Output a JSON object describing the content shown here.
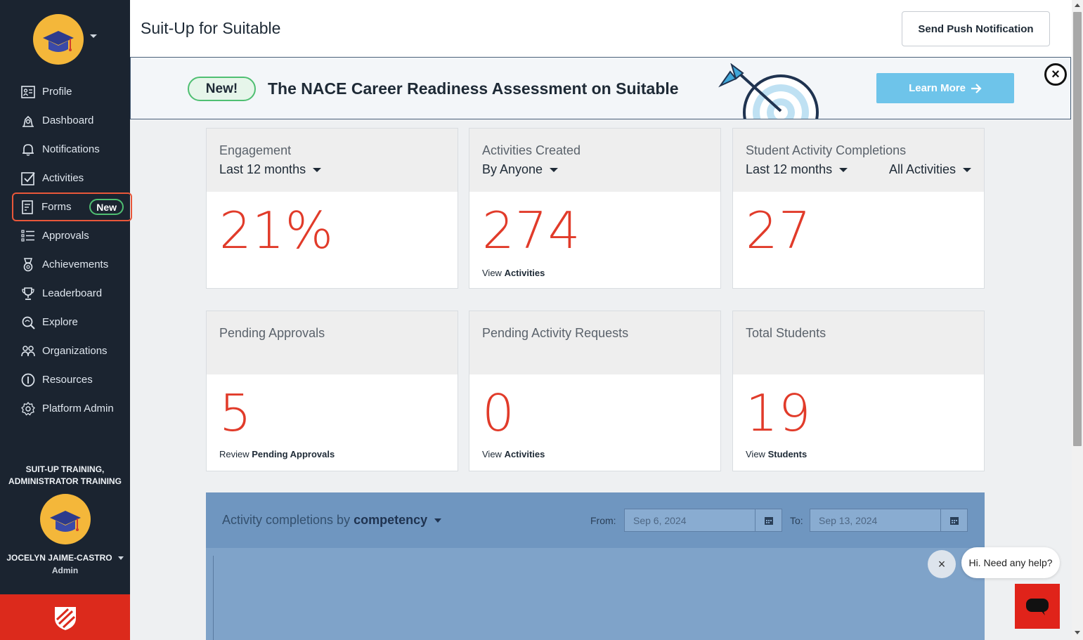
{
  "header": {
    "title": "Suit-Up for Suitable",
    "push_button": "Send Push Notification"
  },
  "banner": {
    "badge": "New!",
    "text": "The NACE Career Readiness Assessment on Suitable",
    "cta": "Learn More",
    "close_glyph": "×"
  },
  "sidebar": {
    "items": [
      {
        "label": "Profile",
        "icon": "profile-icon"
      },
      {
        "label": "Dashboard",
        "icon": "dashboard-icon"
      },
      {
        "label": "Notifications",
        "icon": "bell-icon"
      },
      {
        "label": "Activities",
        "icon": "checkbox-icon"
      },
      {
        "label": "Forms",
        "icon": "form-icon",
        "badge": "New"
      },
      {
        "label": "Approvals",
        "icon": "list-check-icon"
      },
      {
        "label": "Achievements",
        "icon": "medal-icon"
      },
      {
        "label": "Leaderboard",
        "icon": "trophy-icon"
      },
      {
        "label": "Explore",
        "icon": "explore-icon"
      },
      {
        "label": "Organizations",
        "icon": "group-icon"
      },
      {
        "label": "Resources",
        "icon": "info-icon"
      },
      {
        "label": "Platform Admin",
        "icon": "gear-icon"
      }
    ],
    "org_line1": "SUIT-UP TRAINING,",
    "org_line2": "ADMINISTRATOR TRAINING",
    "user_name": "JOCELYN JAIME-CASTRO",
    "user_role": "Admin"
  },
  "cards": [
    {
      "title": "Engagement",
      "filter": "Last 12 months",
      "value": "21%"
    },
    {
      "title": "Activities Created",
      "filter": "By Anyone",
      "value": "274",
      "link_prefix": "View ",
      "link_bold": "Activities"
    },
    {
      "title": "Student Activity Completions",
      "filter": "Last 12 months",
      "filter2": "All Activities",
      "value": "27"
    },
    {
      "title": "Pending Approvals",
      "value": "5",
      "link_prefix": "Review ",
      "link_bold": "Pending Approvals"
    },
    {
      "title": "Pending Activity Requests",
      "value": "0",
      "link_prefix": "View ",
      "link_bold": "Activities"
    },
    {
      "title": "Total Students",
      "value": "19",
      "link_prefix": "View ",
      "link_bold": "Students"
    }
  ],
  "chart_panel": {
    "label": "Activity completions by",
    "dimension": "competency",
    "from_label": "From:",
    "from_value": "Sep 6, 2024",
    "to_label": "To:",
    "to_value": "Sep 13, 2024"
  },
  "help": {
    "close_glyph": "×",
    "bubble": "Hi. Need any help?"
  },
  "colors": {
    "sidebar": "#1b2430",
    "accent_red": "#e13b2a",
    "brand_red": "#dc2a1c",
    "badge_green": "#4fbf72",
    "cta_blue": "#6ec4ea"
  }
}
